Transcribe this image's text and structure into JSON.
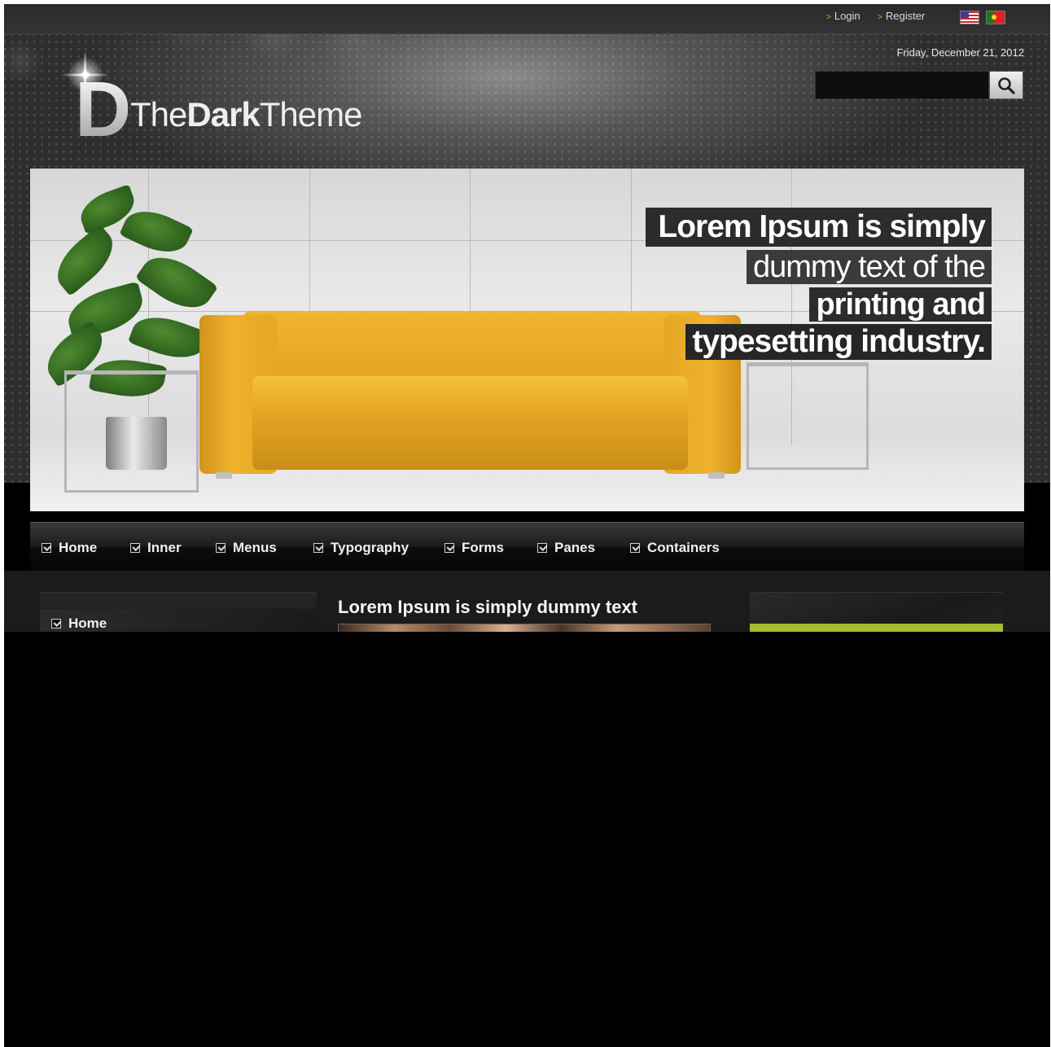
{
  "topbar": {
    "login_label": "Login",
    "register_label": "Register",
    "link_arrow": ">",
    "accent_color": "#a7c23b"
  },
  "header": {
    "date": "Friday, December 21, 2012",
    "logo": {
      "letter": "D",
      "text_light": "The",
      "text_bold": "Dark",
      "text_end": "Theme"
    },
    "search": {
      "placeholder": "",
      "value": "",
      "icon": "search-icon"
    }
  },
  "banner": {
    "caption_lines": [
      "Lorem Ipsum is simply",
      "dummy text of the",
      "printing and",
      "typesetting industry."
    ]
  },
  "mainnav": {
    "items": [
      {
        "label": "Home"
      },
      {
        "label": "Inner"
      },
      {
        "label": "Menus"
      },
      {
        "label": "Typography"
      },
      {
        "label": "Forms"
      },
      {
        "label": "Panes"
      },
      {
        "label": "Containers"
      }
    ],
    "item_icon": "checkbox-chevron-icon"
  },
  "sidebar": {
    "items": [
      {
        "label": "Home"
      }
    ]
  },
  "article": {
    "title": "Lorem Ipsum is simply dummy text"
  },
  "colors": {
    "right_box_accent": "#a3bd33",
    "page_background": "#000000"
  }
}
